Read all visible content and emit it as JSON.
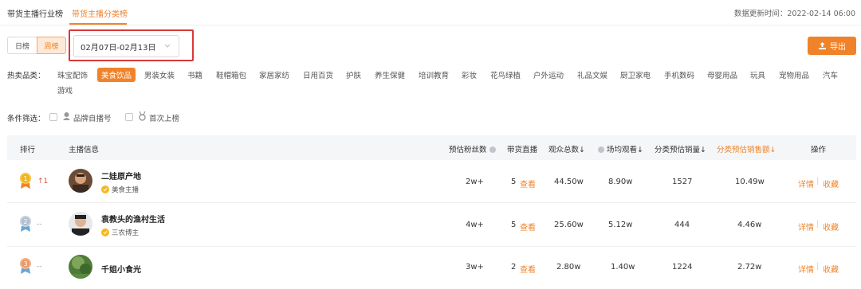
{
  "tabs": [
    "带货主播行业榜",
    "带货主播分类榜"
  ],
  "active_tab": 1,
  "updated_label": "数据更新时间：2022-02-14 06:00",
  "period": {
    "day": "日榜",
    "week": "周榜",
    "active": "week"
  },
  "date_range": "02月07日-02月13日",
  "export_label": "导出",
  "categories_label": "热卖品类：",
  "categories": [
    "珠宝配饰",
    "美食饮品",
    "男装女装",
    "书籍",
    "鞋帽箱包",
    "家居家纺",
    "日用百货",
    "护肤",
    "养生保健",
    "培训教育",
    "彩妆",
    "花鸟绿植",
    "户外运动",
    "礼品文娱",
    "厨卫家电",
    "手机数码",
    "母婴用品",
    "玩具",
    "宠物用品",
    "汽车",
    "游戏"
  ],
  "active_category": "美食饮品",
  "filters_label": "条件筛选：",
  "filters": [
    "品牌自播号",
    "首次上榜"
  ],
  "columns": {
    "rank": "排行",
    "anchor": "主播信息",
    "fans": "预估粉丝数",
    "live": "带货直播",
    "viewers": "观众总数",
    "per_show": "场均观看",
    "sales_qty": "分类预估销量",
    "sales_amount": "分类预估销售额",
    "actions": "操作"
  },
  "sort_arrow": "↓",
  "view_label": "查看",
  "detail_label": "详情",
  "favorite_label": "收藏",
  "rows": [
    {
      "rank": "1",
      "change": "1",
      "name": "二娃原产地",
      "tag": "美食主播",
      "fans": "2w+",
      "live": "5",
      "viewers": "44.50w",
      "per_show": "8.90w",
      "sales_qty": "1527",
      "sales_amount": "10.49w"
    },
    {
      "rank": "2",
      "change": "--",
      "name": "袁教头的渔村生活",
      "tag": "三农博主",
      "fans": "4w+",
      "live": "5",
      "viewers": "25.60w",
      "per_show": "5.12w",
      "sales_qty": "444",
      "sales_amount": "4.46w"
    },
    {
      "rank": "3",
      "change": "--",
      "name": "千姐小食光",
      "tag": "",
      "fans": "3w+",
      "live": "2",
      "viewers": "2.80w",
      "per_show": "1.40w",
      "sales_qty": "1224",
      "sales_amount": "2.72w"
    }
  ],
  "colors": {
    "accent": "#f0832a",
    "highlight": "#d9383a",
    "up": "#e0523a"
  }
}
